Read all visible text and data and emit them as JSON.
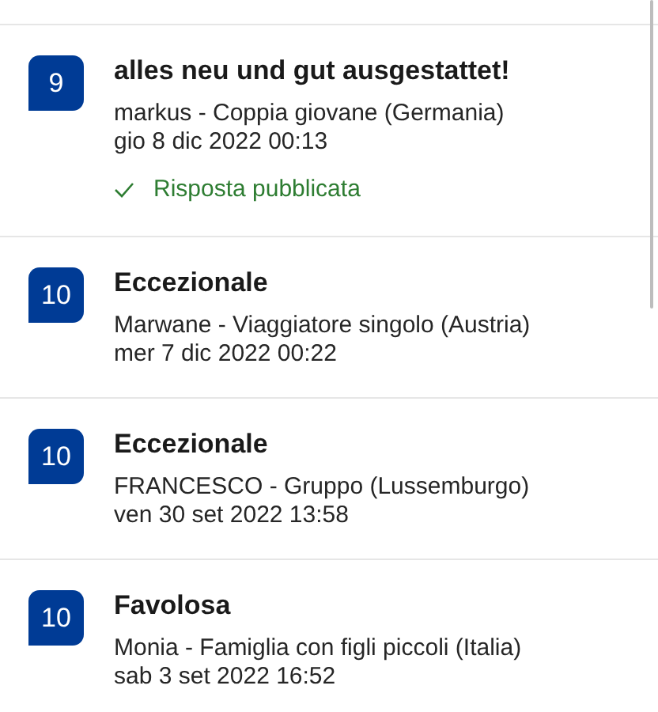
{
  "reviews": [
    {
      "score": "9",
      "title": "alles neu und gut ausgestattet!",
      "author": "markus - Coppia giovane (Germania)",
      "date": "gio 8 dic 2022 00:13",
      "replied": true,
      "reply_label": "Risposta pubblicata"
    },
    {
      "score": "10",
      "title": "Eccezionale",
      "author": "Marwane - Viaggiatore singolo (Austria)",
      "date": "mer 7 dic 2022 00:22",
      "replied": false
    },
    {
      "score": "10",
      "title": "Eccezionale",
      "author": "FRANCESCO - Gruppo (Lussemburgo)",
      "date": "ven 30 set 2022 13:58",
      "replied": false
    },
    {
      "score": "10",
      "title": "Favolosa",
      "author": "Monia - Famiglia con figli piccoli (Italia)",
      "date": "sab 3 set 2022 16:52",
      "replied": false
    }
  ]
}
